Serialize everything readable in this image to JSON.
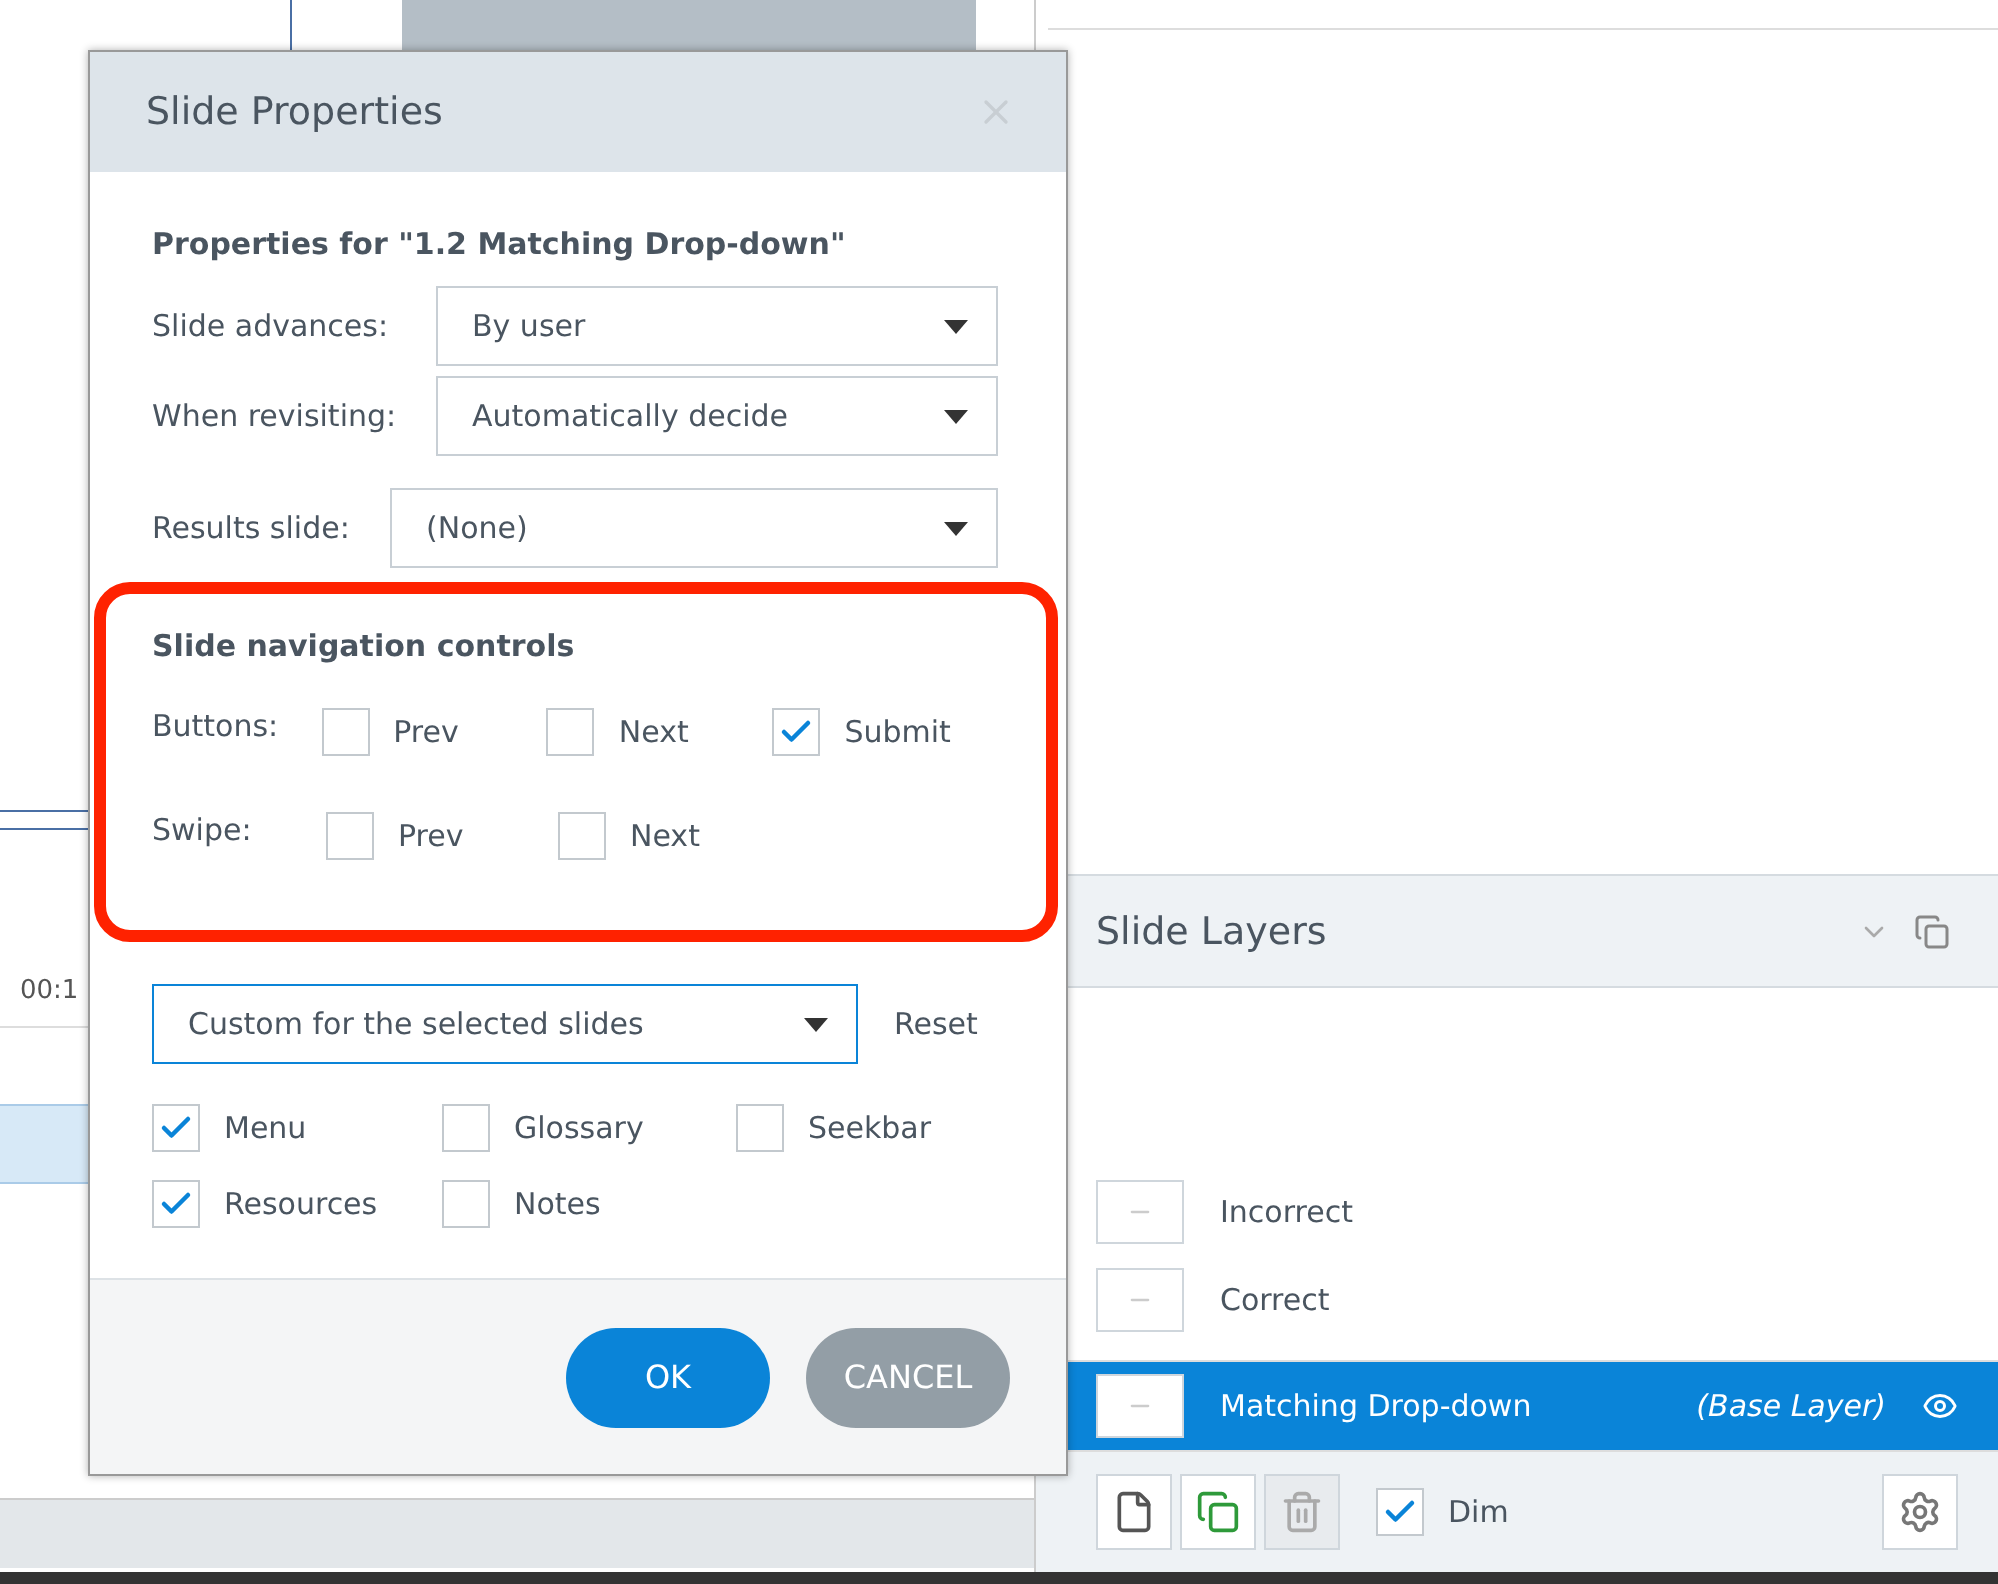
{
  "dialog": {
    "title": "Slide Properties",
    "heading": "Properties for \"1.2 Matching Drop-down\"",
    "fields": [
      {
        "label": "Slide advances:",
        "value": "By user"
      },
      {
        "label": "When revisiting:",
        "value": "Automatically decide"
      },
      {
        "label": "Results slide:",
        "value": "(None)"
      }
    ],
    "navigation": {
      "heading": "Slide navigation controls",
      "rows": [
        {
          "label": "Buttons:",
          "options": [
            {
              "label": "Prev",
              "checked": false
            },
            {
              "label": "Next",
              "checked": false
            },
            {
              "label": "Submit",
              "checked": true
            }
          ]
        },
        {
          "label": "Swipe:",
          "options": [
            {
              "label": "Prev",
              "checked": false
            },
            {
              "label": "Next",
              "checked": false
            }
          ]
        }
      ]
    },
    "player_features": {
      "preset": "Custom for the selected slides",
      "reset": "Reset",
      "options": [
        {
          "label": "Menu",
          "checked": true
        },
        {
          "label": "Glossary",
          "checked": false
        },
        {
          "label": "Seekbar",
          "checked": false
        },
        {
          "label": "Resources",
          "checked": true
        },
        {
          "label": "Notes",
          "checked": false
        }
      ]
    },
    "buttons": [
      {
        "label": "OK",
        "kind": "primary"
      },
      {
        "label": "CANCEL",
        "kind": "secondary"
      }
    ]
  },
  "timeline": {
    "time": "00:1"
  },
  "slide_layers": {
    "title": "Slide Layers",
    "layers": [
      {
        "name": "Incorrect",
        "selected": false
      },
      {
        "name": "Correct",
        "selected": false
      },
      {
        "name": "Matching Drop-down",
        "tag": "(Base Layer)",
        "selected": true
      }
    ],
    "dim": {
      "label": "Dim",
      "checked": true
    }
  }
}
